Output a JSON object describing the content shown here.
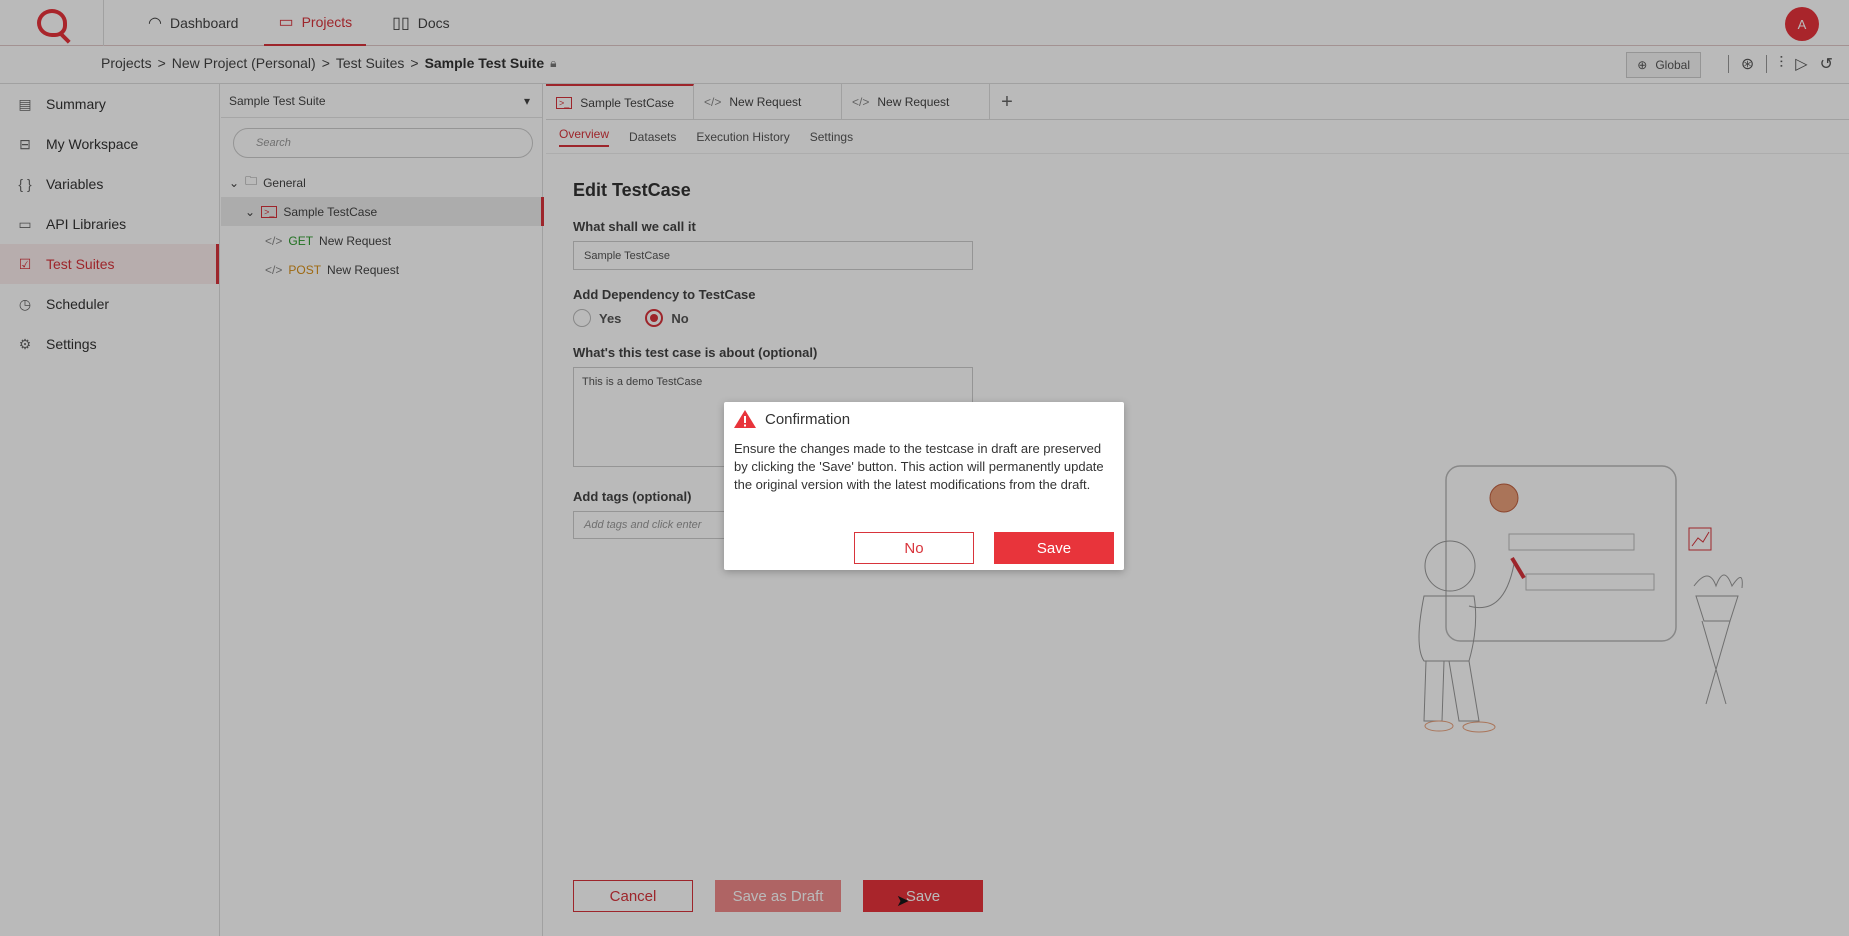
{
  "nav": {
    "items": [
      {
        "label": "Dashboard",
        "icon": "gauge-icon"
      },
      {
        "label": "Projects",
        "icon": "folder-icon"
      },
      {
        "label": "Docs",
        "icon": "book-icon"
      }
    ],
    "avatar": "A"
  },
  "breadcrumb": {
    "items": [
      "Projects",
      "New Project (Personal)",
      "Test Suites"
    ],
    "current": "Sample Test Suite",
    "env": "Global"
  },
  "sidebar": {
    "items": [
      {
        "label": "Summary",
        "icon": "clipboard-icon"
      },
      {
        "label": "My Workspace",
        "icon": "inbox-icon"
      },
      {
        "label": "Variables",
        "icon": "braces-icon"
      },
      {
        "label": "API Libraries",
        "icon": "folder-icon"
      },
      {
        "label": "Test Suites",
        "icon": "checklist-icon"
      },
      {
        "label": "Scheduler",
        "icon": "clock-icon"
      },
      {
        "label": "Settings",
        "icon": "gear-icon"
      }
    ]
  },
  "tree": {
    "suite": "Sample Test Suite",
    "search_placeholder": "Search",
    "folder": "General",
    "testcase": "Sample TestCase",
    "requests": [
      {
        "method": "GET",
        "name": "New Request"
      },
      {
        "method": "POST",
        "name": "New Request"
      }
    ]
  },
  "tabs": [
    "Sample TestCase",
    "New Request",
    "New Request"
  ],
  "subtabs": [
    "Overview",
    "Datasets",
    "Execution History",
    "Settings"
  ],
  "form": {
    "title": "Edit TestCase",
    "name_label": "What shall we call it",
    "name_value": "Sample TestCase",
    "dependency_label": "Add Dependency to TestCase",
    "yes": "Yes",
    "no": "No",
    "about_label": "What's this test case is about (optional)",
    "about_value": "This is a demo TestCase",
    "tags_label": "Add tags (optional)",
    "tags_placeholder": "Add tags and click enter"
  },
  "actions": {
    "cancel": "Cancel",
    "draft": "Save as Draft",
    "save": "Save"
  },
  "modal": {
    "title": "Confirmation",
    "body": "Ensure the changes made to the testcase in draft are preserved by clicking the 'Save' button. This action will permanently update the original version with the latest modifications from the draft.",
    "no": "No",
    "save": "Save"
  },
  "colors": {
    "accent": "#e8343b"
  }
}
